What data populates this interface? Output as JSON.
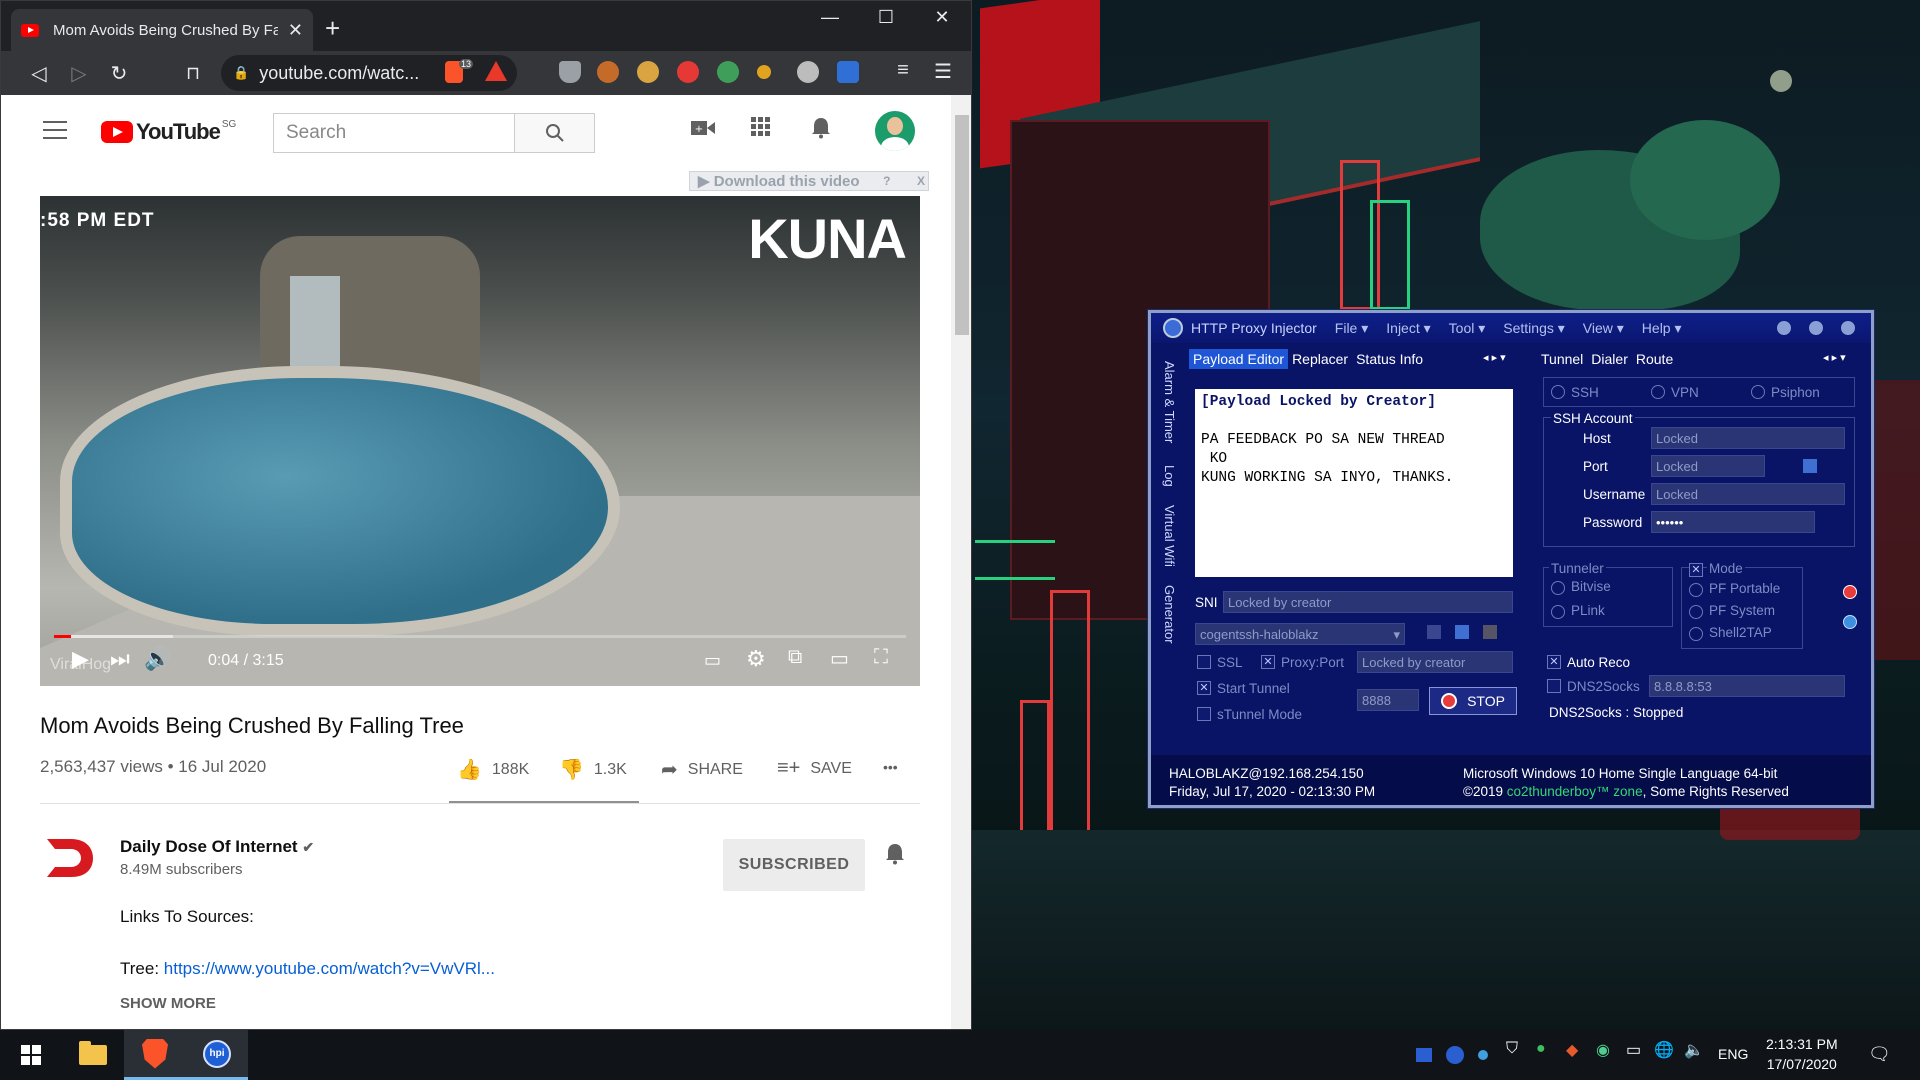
{
  "browser": {
    "tab_title": "Mom Avoids Being Crushed By Fall",
    "new_tab": "+",
    "window_controls": {
      "minimize": "—",
      "maximize": "☐",
      "close": "✕"
    },
    "address": "youtube.com/watc...",
    "brave_shield_count": "13"
  },
  "youtube": {
    "logo_word": "YouTube",
    "country": "SG",
    "search_placeholder": "Search",
    "download_bar": "▶ Download this video",
    "download_help": "?",
    "download_close": "X",
    "video": {
      "timestamp": ":58 PM EDT",
      "watermark": "KUNA",
      "viralhog": "ViralHog",
      "time": "0:04 / 3:15",
      "progress_played": 0.02,
      "progress_buffered": 0.14
    },
    "title": "Mom Avoids Being Crushed By Falling Tree",
    "views_date": "2,563,437 views • 16 Jul 2020",
    "likes": "188K",
    "dislikes": "1.3K",
    "share": "SHARE",
    "save": "SAVE",
    "more": "•••",
    "channel": {
      "name": "Daily Dose Of Internet",
      "subscribers": "8.49M subscribers",
      "subscribe_label": "SUBSCRIBED"
    },
    "description": {
      "line1": "Links To Sources:",
      "tree_label": "Tree: ",
      "tree_link": "https://www.youtube.com/watch?v=VwVRl...",
      "show_more": "SHOW MORE"
    }
  },
  "proxy": {
    "title": "HTTP Proxy Injector",
    "menus": [
      "File ▾",
      "Inject ▾",
      "Tool ▾",
      "Settings ▾",
      "View ▾",
      "Help ▾"
    ],
    "side_tabs": [
      "Alarm & Timer",
      "Log",
      "Virtual Wifi",
      "Generator"
    ],
    "left_tabs": [
      "Payload Editor",
      "Replacer",
      "Status Info"
    ],
    "right_tabs": [
      "Tunnel",
      "Dialer",
      "Route"
    ],
    "payload_header": "[Payload Locked by Creator]",
    "payload_body1": "PA FEEDBACK PO SA NEW THREAD",
    "payload_body2": " KO",
    "payload_body3": "KUNG WORKING SA INYO, THANKS.",
    "sni_label": "SNI",
    "sni_value": "Locked by creator",
    "profile": "cogentssh-haloblakz",
    "ssl_label": "SSL",
    "proxy_port_label": "Proxy:Port",
    "proxy_port_value": "Locked by creator",
    "start_tunnel": "Start Tunnel",
    "stunnel_mode": "sTunnel Mode",
    "port_value": "8888",
    "stop": "STOP",
    "conn_types": [
      "SSH",
      "VPN",
      "Psiphon"
    ],
    "ssh_account": "SSH Account",
    "host_label": "Host",
    "host_value": "Locked",
    "port_label": "Port",
    "port_field": "Locked",
    "username_label": "Username",
    "username_value": "Locked",
    "password_label": "Password",
    "password_value": "••••••",
    "tunneler_label": "Tunneler",
    "tunnelers": [
      "Bitvise",
      "PLink"
    ],
    "mode_label": "Mode",
    "modes": [
      "PF Portable",
      "PF System",
      "Shell2TAP"
    ],
    "auto_reco": "Auto Reco",
    "dns2socks": "DNS2Socks",
    "dns_value": "8.8.8.8:53",
    "dns_status": "DNS2Socks : Stopped",
    "footer_user": "HALOBLAKZ@192.168.254.150",
    "footer_date": "Friday, Jul 17, 2020 - 02:13:30 PM",
    "footer_os": "Microsoft Windows 10 Home Single Language 64-bit",
    "footer_copy_pre": "©2019 ",
    "footer_copy_brand": "co2thunderboy™ zone",
    "footer_copy_post": ", Some Rights Reserved"
  },
  "taskbar": {
    "lang": "ENG",
    "time": "2:13:31 PM",
    "date": "17/07/2020"
  }
}
